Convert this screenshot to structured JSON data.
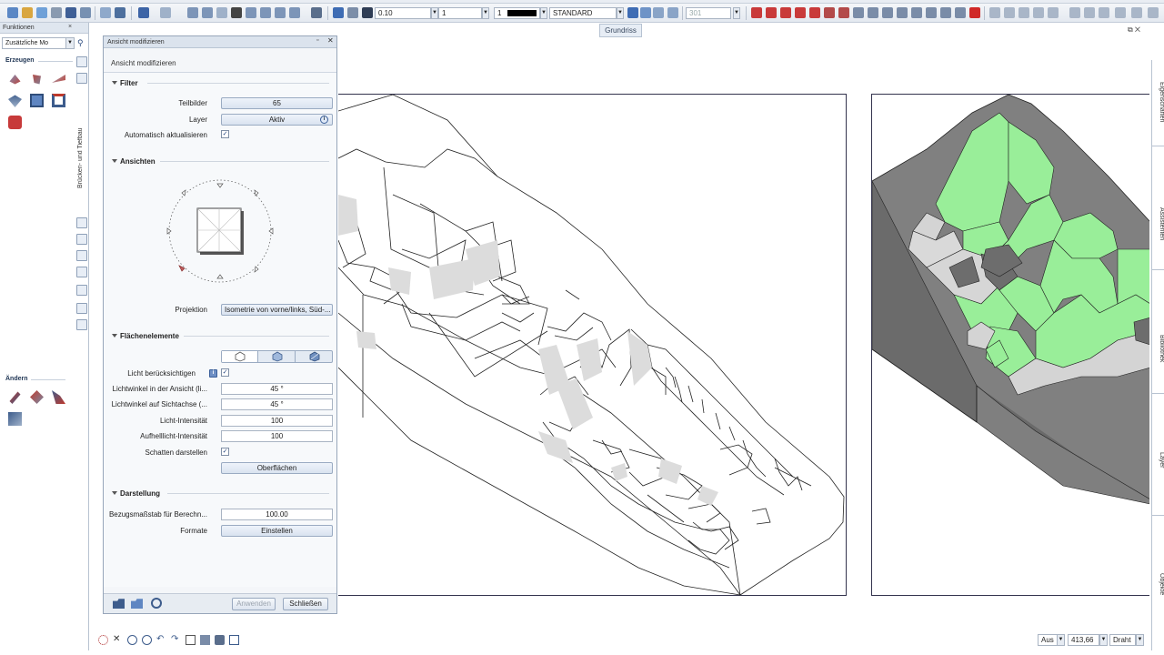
{
  "toolbar": {
    "pen_thickness": "0.10",
    "line_type": "1",
    "color_index": "1",
    "layer": "STANDARD",
    "scale_readout": "301"
  },
  "view_tab": {
    "label": "Grundriss"
  },
  "functions_panel": {
    "title": "Funktionen",
    "close_label": "×",
    "module_select": "Zusätzliche Mo",
    "section_create": "Erzeugen",
    "section_modify": "Ändern",
    "vertical_tab": "Brücken- und Tiefbau"
  },
  "dialog": {
    "title": "Ansicht modifizieren",
    "subtitle": "Ansicht modifizieren",
    "pin": "▫",
    "close": "✕",
    "filter": {
      "heading": "Filter",
      "teilbilder_label": "Teilbilder",
      "teilbilder_value": "65",
      "layer_label": "Layer",
      "layer_value": "Aktiv",
      "auto_update_label": "Automatisch aktualisieren",
      "auto_update_checked": "✓"
    },
    "views": {
      "heading": "Ansichten",
      "projection_label": "Projektion",
      "projection_value": "Isometrie von vorne/links, Süd-..."
    },
    "surfaces": {
      "heading": "Flächenelemente",
      "light_label": "Licht berücksichtigen",
      "light_checked": "✓",
      "light_angle_view_label": "Lichtwinkel in der Ansicht (li...",
      "light_angle_view_value": "45 °",
      "light_angle_axis_label": "Lichtwinkel auf Sichtachse (...",
      "light_angle_axis_value": "45 °",
      "light_intensity_label": "Licht-Intensität",
      "light_intensity_value": "100",
      "fill_light_label": "Aufhelllicht-Intensität",
      "fill_light_value": "100",
      "shadow_label": "Schatten darstellen",
      "shadow_checked": "✓",
      "surfaces_button": "Oberflächen"
    },
    "display": {
      "heading": "Darstellung",
      "scale_label": "Bezugsmaßstab für Berechn...",
      "scale_value": "100.00",
      "formats_label": "Formate",
      "formats_button": "Einstellen"
    },
    "footer": {
      "apply": "Anwenden",
      "close": "Schließen"
    }
  },
  "right_tabs": [
    "Eigenschaften",
    "Assistenten",
    "Bibliothek",
    "Layer",
    "Objekte"
  ],
  "status": {
    "mode": "Aus",
    "value": "413,66",
    "draw_mode": "Draht"
  },
  "colors": {
    "green_fill": "#99ee99",
    "gray_fill": "#7a7a7a",
    "light_gray": "#dcdcdc"
  }
}
